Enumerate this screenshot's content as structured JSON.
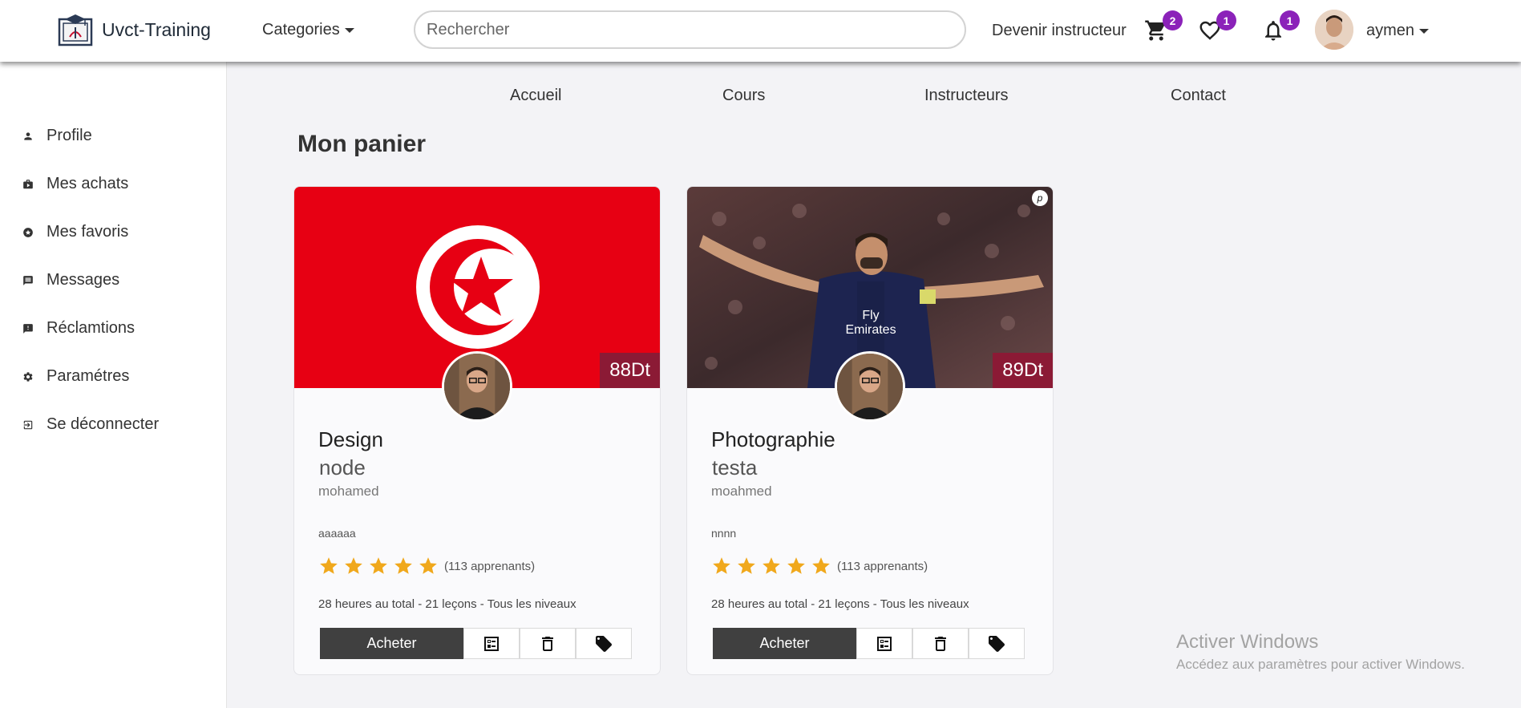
{
  "navbar": {
    "brand": "Uvct-Training",
    "categories_label": "Categories",
    "search_placeholder": "Rechercher",
    "become_instructor": "Devenir instructeur",
    "cart_count": "2",
    "favorites_count": "1",
    "notifications_count": "1",
    "username": "aymen"
  },
  "sidebar": {
    "items": [
      {
        "label": "Profile",
        "icon": "person-icon"
      },
      {
        "label": "Mes achats",
        "icon": "purchases-icon"
      },
      {
        "label": "Mes favoris",
        "icon": "star-circle-icon"
      },
      {
        "label": "Messages",
        "icon": "message-icon"
      },
      {
        "label": "Réclamtions",
        "icon": "report-icon"
      },
      {
        "label": "Paramétres",
        "icon": "gear-icon"
      },
      {
        "label": "Se déconnecter",
        "icon": "logout-icon"
      }
    ]
  },
  "subnav": {
    "items": [
      "Accueil",
      "Cours",
      "Instructeurs",
      "Contact"
    ]
  },
  "page_title": "Mon panier",
  "cards": [
    {
      "title": "Design",
      "subtitle": "node",
      "author": "mohamed",
      "description": "aaaaaa",
      "price": "88Dt",
      "rating": 5,
      "learners": "(113 apprenants)",
      "meta": "28 heures au total - 21 leçons - Tous les niveaux",
      "buy_label": "Acheter"
    },
    {
      "title": "Photographie",
      "subtitle": "testa",
      "author": "moahmed",
      "description": "nnnn",
      "price": "89Dt",
      "rating": 5,
      "learners": "(113 apprenants)",
      "meta": "28 heures au total - 21 leçons - Tous les niveaux",
      "buy_label": "Acheter"
    }
  ],
  "watermark": {
    "line1": "Activer Windows",
    "line2": "Accédez aux paramètres pour activer Windows."
  },
  "colors": {
    "badge": "#8b22b9",
    "price_tag": "#8b1a35",
    "buy_button": "#404040",
    "star": "#f0a81c",
    "flag_red": "#e70013"
  }
}
